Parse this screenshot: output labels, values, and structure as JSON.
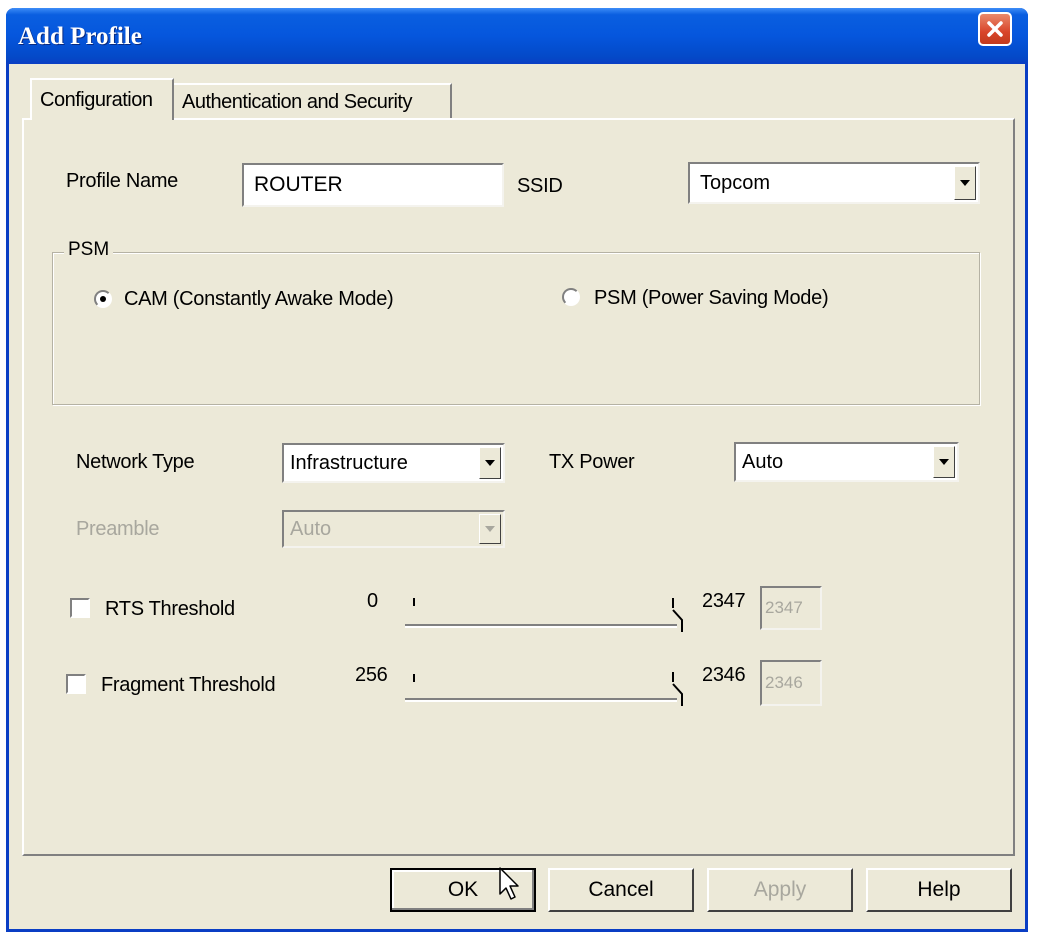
{
  "window": {
    "title": "Add Profile",
    "close_icon": "close-icon"
  },
  "tabs": [
    {
      "label": "Configuration",
      "active": true
    },
    {
      "label": "Authentication and Security",
      "active": false
    }
  ],
  "profile": {
    "name_label": "Profile Name",
    "name_value": "ROUTER",
    "ssid_label": "SSID",
    "ssid_value": "Topcom"
  },
  "psm": {
    "group_label": "PSM",
    "options": [
      {
        "label": "CAM (Constantly Awake Mode)",
        "selected": true
      },
      {
        "label": "PSM (Power Saving Mode)",
        "selected": false
      }
    ]
  },
  "network": {
    "type_label": "Network Type",
    "type_value": "Infrastructure",
    "tx_power_label": "TX Power",
    "tx_power_value": "Auto",
    "preamble_label": "Preamble",
    "preamble_value": "Auto"
  },
  "rts": {
    "label": "RTS Threshold",
    "checked": false,
    "min": "0",
    "max": "2347",
    "value": "2347"
  },
  "fragment": {
    "label": "Fragment Threshold",
    "checked": false,
    "min": "256",
    "max": "2346",
    "value": "2346"
  },
  "buttons": {
    "ok": "OK",
    "cancel": "Cancel",
    "apply": "Apply",
    "help": "Help"
  },
  "colors": {
    "titlebar": "#0556dd",
    "dialog_bg": "#ece9d8",
    "disabled_text": "#a8a79e"
  }
}
